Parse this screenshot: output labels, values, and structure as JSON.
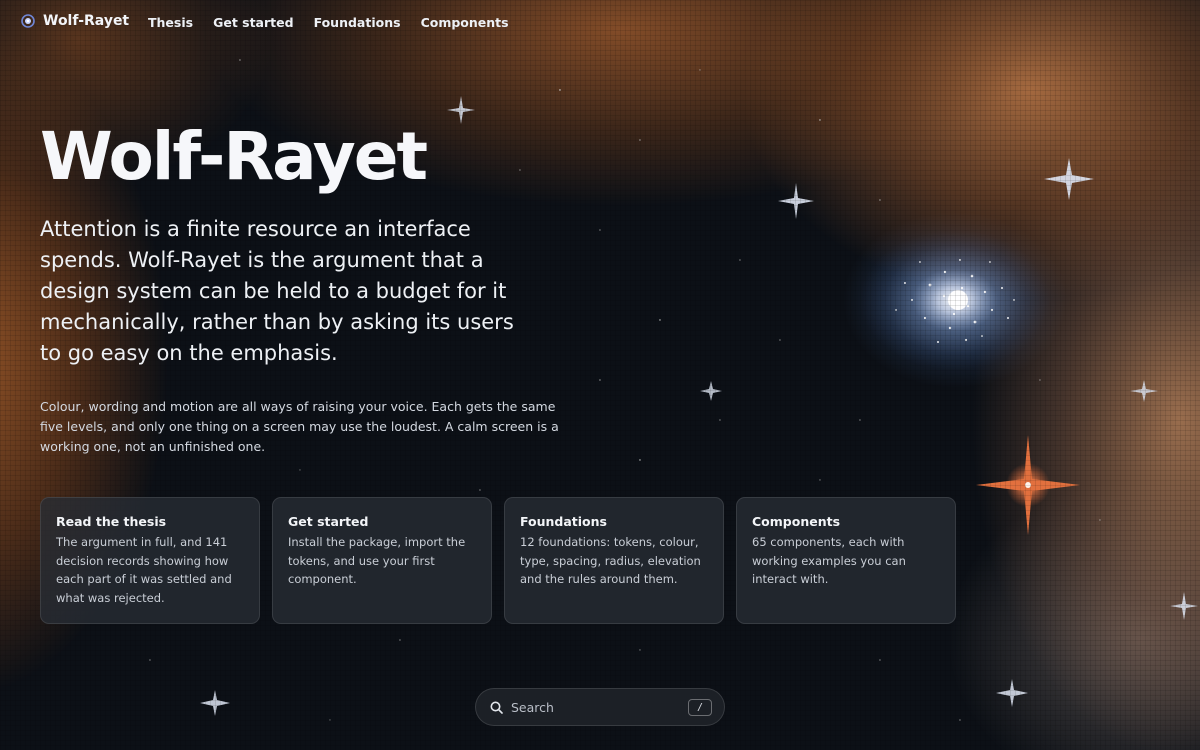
{
  "nav": {
    "brand": "Wolf-Rayet",
    "links": [
      {
        "label": "Thesis"
      },
      {
        "label": "Get started"
      },
      {
        "label": "Foundations"
      },
      {
        "label": "Components"
      }
    ]
  },
  "hero": {
    "title": "Wolf-Rayet",
    "lede": "Attention is a finite resource an interface spends. Wolf-Rayet is the argument that a design system can be held to a budget for it mechanically, rather than by asking its users to go easy on the emphasis.",
    "body": "Colour, wording and motion are all ways of raising your voice. Each gets the same five levels, and only one thing on a screen may use the loudest. A calm screen is a working one, not an unfinished one."
  },
  "cards": [
    {
      "title": "Read the thesis",
      "text": "The argument in full, and 141 decision records showing how each part of it was settled and what was rejected."
    },
    {
      "title": "Get started",
      "text": "Install the package, import the tokens, and use your first component."
    },
    {
      "title": "Foundations",
      "text": "12 foundations: tokens, colour, type, spacing, radius, elevation and the rules around them."
    },
    {
      "title": "Components",
      "text": "65 components, each with working examples you can interact with."
    }
  ],
  "search": {
    "placeholder": "Search",
    "shortcut": "/"
  },
  "icons": {
    "brand": "star-logo-icon",
    "search": "magnifier-icon"
  },
  "colors": {
    "background": "#0b0e13",
    "nebula_orange": "#b0622a",
    "accent_star": "#e06a3a",
    "card_bg": "#282d34",
    "text_primary": "#f3f5f8",
    "text_secondary": "#c9ced6"
  }
}
